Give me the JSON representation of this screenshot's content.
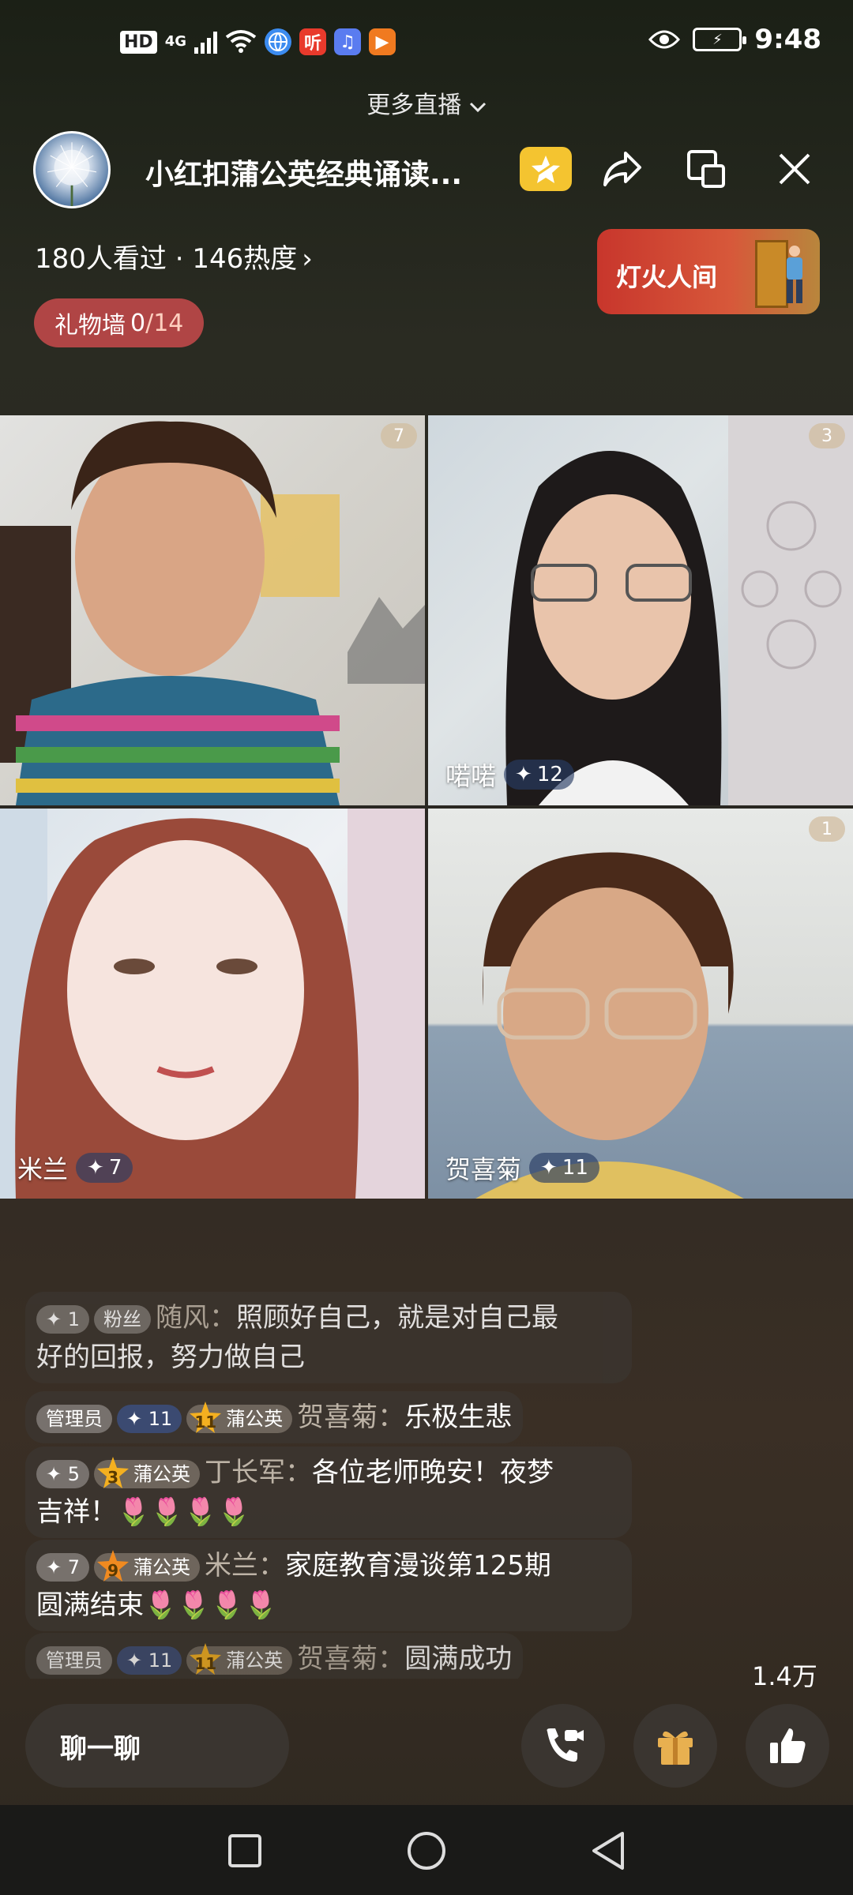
{
  "status_bar": {
    "hd": "HD",
    "network": "4G",
    "app_icons": [
      {
        "name": "browser-icon",
        "color": "#3c8cf0",
        "glyph": ""
      },
      {
        "name": "ting-app-icon",
        "color": "#e83a2c",
        "glyph": "听"
      },
      {
        "name": "music-app-icon",
        "color": "#5a7cf0",
        "glyph": "♫"
      },
      {
        "name": "video-app-icon",
        "color": "#f07a20",
        "glyph": "▶"
      }
    ],
    "time": "9:48"
  },
  "more_live": "更多直播",
  "header": {
    "room_title": "小红扣蒲公英经典诵读...",
    "viewers": "180人看过 · 146热度",
    "gift_wall_label": "礼物墙",
    "gift_wall_count": "0",
    "gift_wall_total": "/14",
    "promo_label": "灯火人间"
  },
  "tiles": [
    {
      "name": "",
      "level": "",
      "badge": "7"
    },
    {
      "name": "喏喏",
      "level": "12",
      "badge": "3"
    },
    {
      "name": "米兰",
      "level": "7",
      "badge": ""
    },
    {
      "name": "贺喜菊",
      "level": "11",
      "badge": "1"
    }
  ],
  "comments": {
    "c1": {
      "tag1": "1",
      "tag2": "粉丝",
      "user": "随风：",
      "text1": "照顾好自己，就是对自己最",
      "text2": "好的回报，努力做自己"
    },
    "c2": {
      "tag1": "管理员",
      "level": "11",
      "star": "11",
      "fan": "蒲公英",
      "user": "贺喜菊：",
      "text": "乐极生悲"
    },
    "c3": {
      "level": "5",
      "star": "3",
      "fan": "蒲公英",
      "user": "丁长军：",
      "text1": "各位老师晚安！夜梦",
      "text2": "吉祥！🌷🌷🌷🌷"
    },
    "c4": {
      "level": "7",
      "star": "9",
      "fan": "蒲公英",
      "user": "米兰：",
      "text1": "家庭教育漫谈第125期",
      "text2": "圆满结束🌷🌷🌷🌷"
    },
    "c5": {
      "tag1": "管理员",
      "level": "11",
      "star": "11",
      "fan": "蒲公英",
      "user": "贺喜菊：",
      "text": "圆满成功"
    }
  },
  "like_count": "1.4万",
  "chat_placeholder": "聊一聊",
  "colors": {
    "gift_wall": "#b04545",
    "vip": "#f4c430",
    "promo": "#c8362c"
  }
}
